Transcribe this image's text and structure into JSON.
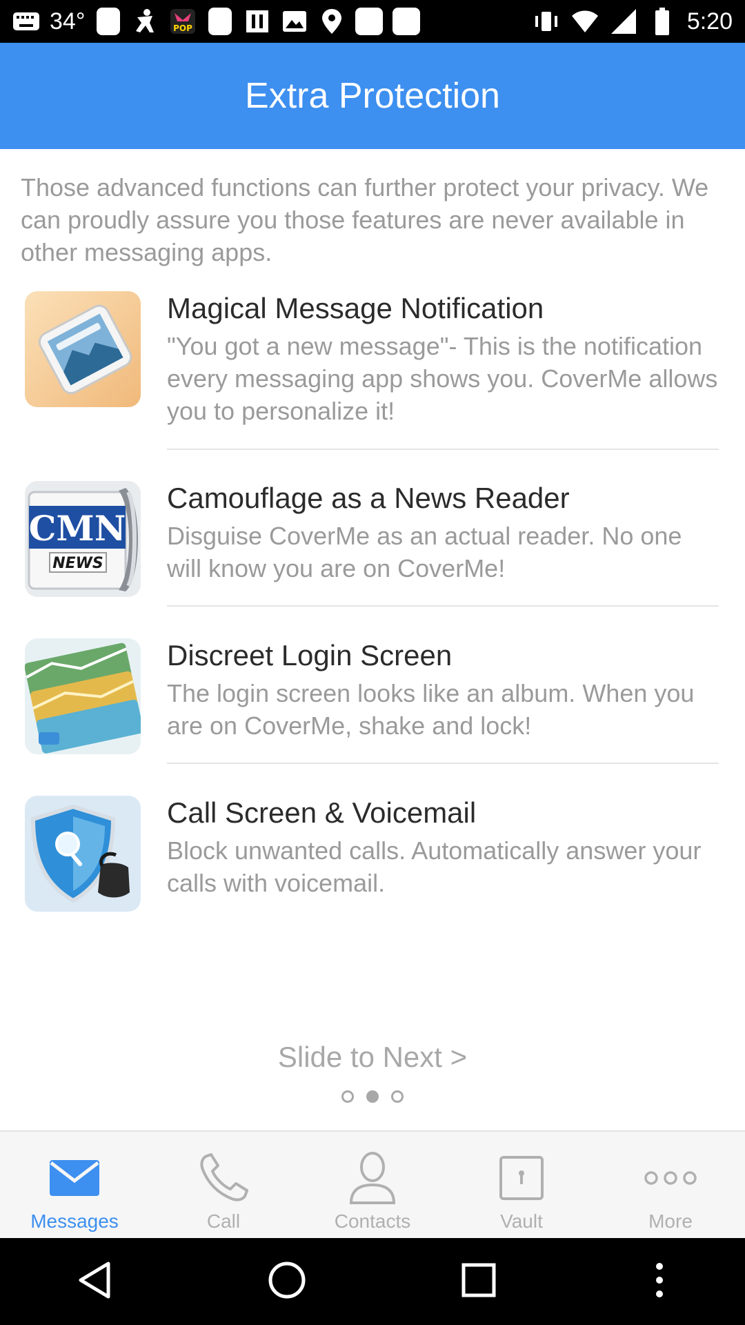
{
  "status_bar": {
    "temperature": "34°",
    "time": "5:20",
    "icons": [
      "keyboard-icon",
      "sim-icon",
      "person-icon",
      "pop-app-icon",
      "sim-icon",
      "pause-icon",
      "photo-icon",
      "location-icon",
      "calendar-icon",
      "sim-icon",
      "vibrate-icon",
      "wifi-icon",
      "signal-icon",
      "battery-icon"
    ]
  },
  "header": {
    "title": "Extra Protection"
  },
  "intro": "Those advanced functions can further protect your privacy. We can proudly assure you those features are never available in other messaging apps.",
  "features": [
    {
      "title": "Magical Message Notification",
      "description": "\"You got a new message\"- This is the notification every messaging app shows you. CoverMe allows you to personalize it!",
      "icon": "phone-notification-icon"
    },
    {
      "title": "Camouflage as a News Reader",
      "description": "Disguise CoverMe as an actual reader. No one will know you are on CoverMe!",
      "icon": "news-reader-icon",
      "icon_text_top": "CMN",
      "icon_text_bottom": "NEWS"
    },
    {
      "title": "Discreet Login Screen",
      "description": "The login screen looks like an album. When you are on CoverMe, shake and lock!",
      "icon": "photo-album-icon"
    },
    {
      "title": "Call Screen & Voicemail",
      "description": "Block unwanted calls. Automatically answer your calls with voicemail.",
      "icon": "shield-phone-icon"
    }
  ],
  "pager": {
    "label": "Slide to Next >",
    "page_count": 3,
    "active_index": 1
  },
  "tabs": [
    {
      "label": "Messages",
      "icon": "envelope-icon",
      "active": true
    },
    {
      "label": "Call",
      "icon": "phone-icon",
      "active": false
    },
    {
      "label": "Contacts",
      "icon": "person-icon",
      "active": false
    },
    {
      "label": "Vault",
      "icon": "vault-icon",
      "active": false
    },
    {
      "label": "More",
      "icon": "more-icon",
      "active": false
    }
  ],
  "colors": {
    "accent": "#3d8ff0",
    "muted_text": "#9a9a9a",
    "title_text": "#2b2b2b"
  }
}
